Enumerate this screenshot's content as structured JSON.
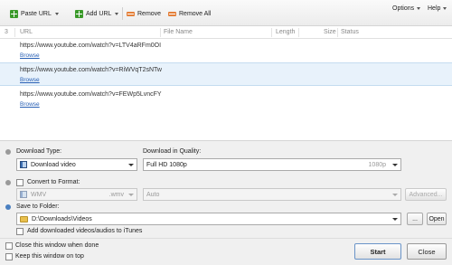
{
  "toolbar": {
    "paste_url": "Paste URL",
    "add_url": "Add URL",
    "remove": "Remove",
    "remove_all": "Remove All",
    "options": "Options",
    "help": "Help"
  },
  "list_header": {
    "count": "3",
    "url": "URL",
    "file_name": "File Name",
    "length": "Length",
    "size": "Size",
    "status": "Status"
  },
  "rows": [
    {
      "url": "https://www.youtube.com/watch?v=LTV4aRFm0OI",
      "browse": "Browse",
      "selected": false
    },
    {
      "url": "https://www.youtube.com/watch?v=RiWVqT2sNTw",
      "browse": "Browse",
      "selected": true
    },
    {
      "url": "https://www.youtube.com/watch?v=FEWp5LvncFY",
      "browse": "Browse",
      "selected": false
    }
  ],
  "download_type": {
    "label": "Download Type:",
    "value": "Download video"
  },
  "quality": {
    "label": "Download in Quality:",
    "value": "Full HD 1080p",
    "hint": "1080p"
  },
  "convert": {
    "label": "Convert to Format:",
    "format": "WMV",
    "ext": ".wmv",
    "preset": "Auto",
    "advanced": "Advanced..."
  },
  "save": {
    "label": "Save to Folder:",
    "path": "D:\\Downloads\\Videos",
    "browse_btn": "...",
    "open_btn": "Open",
    "itunes": "Add downloaded videos/audios to iTunes"
  },
  "bottom": {
    "close_when_done": "Close this window when done",
    "keep_on_top": "Keep this window on top",
    "start": "Start",
    "close": "Close"
  },
  "colors": {
    "accent_blue": "#4a7fc0",
    "bullet_grey": "#9a9a9a",
    "selection": "#e8f2fb"
  }
}
